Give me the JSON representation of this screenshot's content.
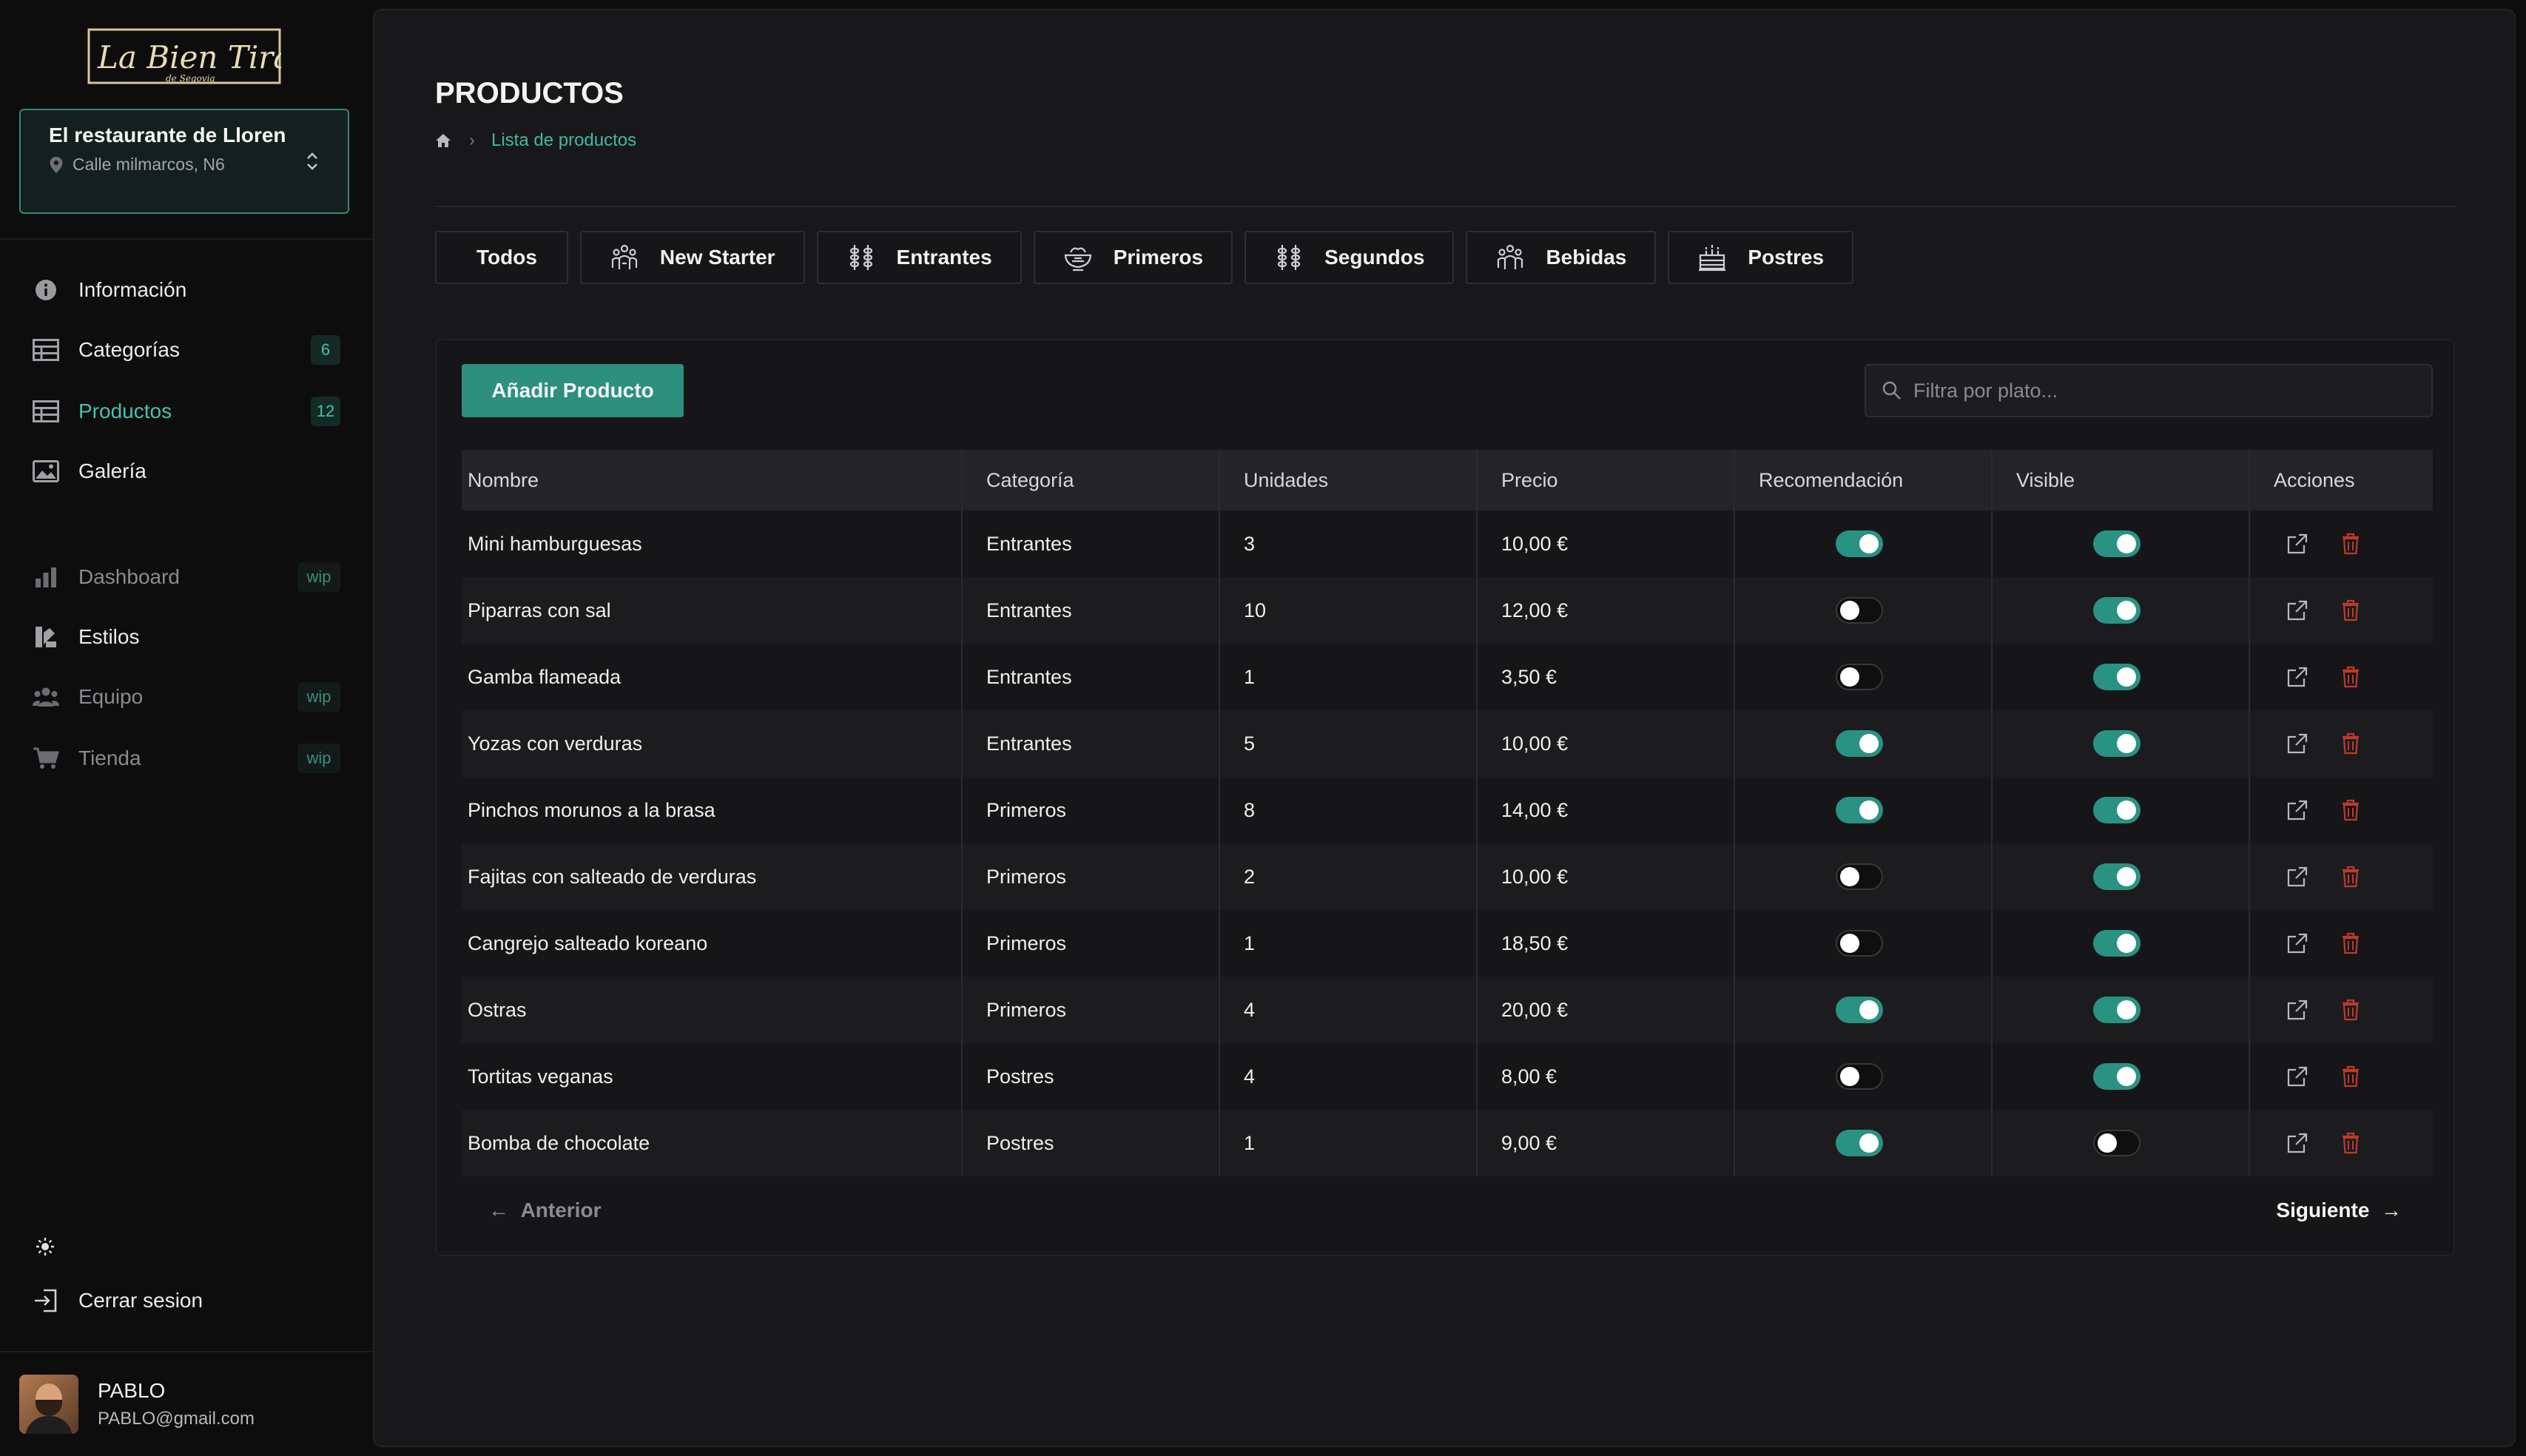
{
  "sidebar": {
    "logo_text": "La Bien Tirada",
    "logo_sub": "de Segovia",
    "restaurant": {
      "name": "El restaurante de Lloren",
      "address": "Calle milmarcos, N6"
    },
    "nav": [
      {
        "label": "Información",
        "icon": "info-icon"
      },
      {
        "label": "Categorías",
        "icon": "table-icon",
        "badge": "6"
      },
      {
        "label": "Productos",
        "icon": "table-icon",
        "badge": "12"
      },
      {
        "label": "Galería",
        "icon": "image-icon"
      },
      {
        "label": "Dashboard",
        "icon": "bar-chart-icon",
        "badge": "wip"
      },
      {
        "label": "Estilos",
        "icon": "palette-icon"
      },
      {
        "label": "Equipo",
        "icon": "team-icon",
        "badge": "wip"
      },
      {
        "label": "Tienda",
        "icon": "cart-icon",
        "badge": "wip"
      }
    ],
    "logout_label": "Cerrar sesion",
    "user": {
      "name": "PABLO",
      "email": "PABLO@gmail.com"
    }
  },
  "main": {
    "title": "PRODUCTOS",
    "breadcrumb": "Lista de productos",
    "category_tabs": [
      "Todos",
      "New Starter",
      "Entrantes",
      "Primeros",
      "Segundos",
      "Bebidas",
      "Postres"
    ],
    "add_button": "Añadir Producto",
    "search_placeholder": "Filtra por plato...",
    "columns": [
      "Nombre",
      "Categoría",
      "Unidades",
      "Precio",
      "Recomendación",
      "Visible",
      "Acciones"
    ],
    "rows": [
      {
        "name": "Mini hamburguesas",
        "category": "Entrantes",
        "units": "3",
        "price": "10,00 €",
        "recommended": true,
        "visible": true
      },
      {
        "name": "Piparras con sal",
        "category": "Entrantes",
        "units": "10",
        "price": "12,00 €",
        "recommended": false,
        "visible": true
      },
      {
        "name": "Gamba flameada",
        "category": "Entrantes",
        "units": "1",
        "price": "3,50 €",
        "recommended": false,
        "visible": true
      },
      {
        "name": "Yozas con verduras",
        "category": "Entrantes",
        "units": "5",
        "price": "10,00 €",
        "recommended": true,
        "visible": true
      },
      {
        "name": "Pinchos morunos a la brasa",
        "category": "Primeros",
        "units": "8",
        "price": "14,00 €",
        "recommended": true,
        "visible": true
      },
      {
        "name": "Fajitas con salteado de verduras",
        "category": "Primeros",
        "units": "2",
        "price": "10,00 €",
        "recommended": false,
        "visible": true
      },
      {
        "name": "Cangrejo salteado koreano",
        "category": "Primeros",
        "units": "1",
        "price": "18,50 €",
        "recommended": false,
        "visible": true
      },
      {
        "name": "Ostras",
        "category": "Primeros",
        "units": "4",
        "price": "20,00 €",
        "recommended": true,
        "visible": true
      },
      {
        "name": "Tortitas veganas",
        "category": "Postres",
        "units": "4",
        "price": "8,00 €",
        "recommended": false,
        "visible": true
      },
      {
        "name": "Bomba de chocolate",
        "category": "Postres",
        "units": "1",
        "price": "9,00 €",
        "recommended": true,
        "visible": false
      }
    ],
    "pager": {
      "prev": "Anterior",
      "next": "Siguiente"
    }
  },
  "colors": {
    "accent": "#2d8f7e",
    "accent_text": "#46c3ad",
    "delete": "#c0392b"
  }
}
